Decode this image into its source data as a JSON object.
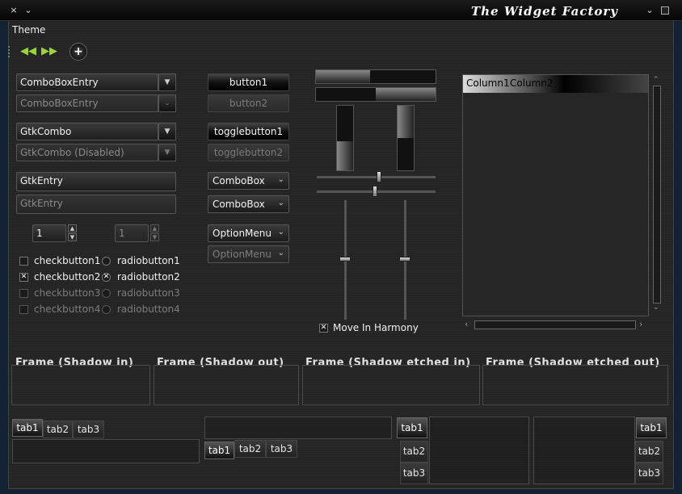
{
  "window": {
    "title": "The Widget Factory",
    "close_glyph": "×",
    "menu_glyph": "⌄",
    "title_chevron": "⌄"
  },
  "menubar": {
    "theme": "Theme"
  },
  "toolbar": {
    "back": "◀◀",
    "forward": "▶▶",
    "add": "+"
  },
  "entries": {
    "comboboxentry": "ComboBoxEntry",
    "comboboxentry_dis": "ComboBoxEntry",
    "gtkcombo": "GtkCombo",
    "gtkcombo_dis": "GtkCombo (Disabled)",
    "gtkentry": "GtkEntry",
    "gtkentry_dis": "GtkEntry"
  },
  "spinners": {
    "spin1": "1",
    "spin2": "1"
  },
  "checks": [
    {
      "check": "checkbutton1",
      "radio": "radiobutton1",
      "checked": false,
      "radio_on": false,
      "disabled": false
    },
    {
      "check": "checkbutton2",
      "radio": "radiobutton2",
      "checked": true,
      "radio_on": true,
      "disabled": false
    },
    {
      "check": "checkbutton3",
      "radio": "radiobutton3",
      "checked": false,
      "radio_on": false,
      "disabled": true
    },
    {
      "check": "checkbutton4",
      "radio": "radiobutton4",
      "checked": false,
      "radio_on": false,
      "disabled": true
    }
  ],
  "buttons": {
    "button1": "button1",
    "button2": "button2",
    "toggle1": "togglebutton1",
    "toggle2": "togglebutton2",
    "combobox1": "ComboBox",
    "combobox2": "ComboBox",
    "optionmenu1": "OptionMenu",
    "optionmenu2": "OptionMenu"
  },
  "harmony": {
    "label": "Move In Harmony",
    "checked": true
  },
  "tree": {
    "col1": "Column1",
    "col2": "Column2"
  },
  "frames": {
    "shadow_in": "Frame (Shadow in)",
    "shadow_out": "Frame (Shadow out)",
    "etched_in": "Frame (Shadow etched in)",
    "etched_out": "Frame (Shadow etched out)"
  },
  "notebooks": {
    "nb1": [
      "tab1",
      "tab2",
      "tab3"
    ],
    "nb2": [
      "tab1",
      "tab2",
      "tab3"
    ],
    "nb3": [
      "tab1",
      "tab2",
      "tab3"
    ],
    "nb4": [
      "tab1",
      "tab2",
      "tab3"
    ]
  },
  "progress": {
    "bar1": 0.45,
    "bar2": 0.5,
    "vbar1": 0.45,
    "vbar2": 0.5
  },
  "colors": {
    "accent": "#000000",
    "text": "#e6e6e6",
    "disabled": "#7d7d7d"
  }
}
